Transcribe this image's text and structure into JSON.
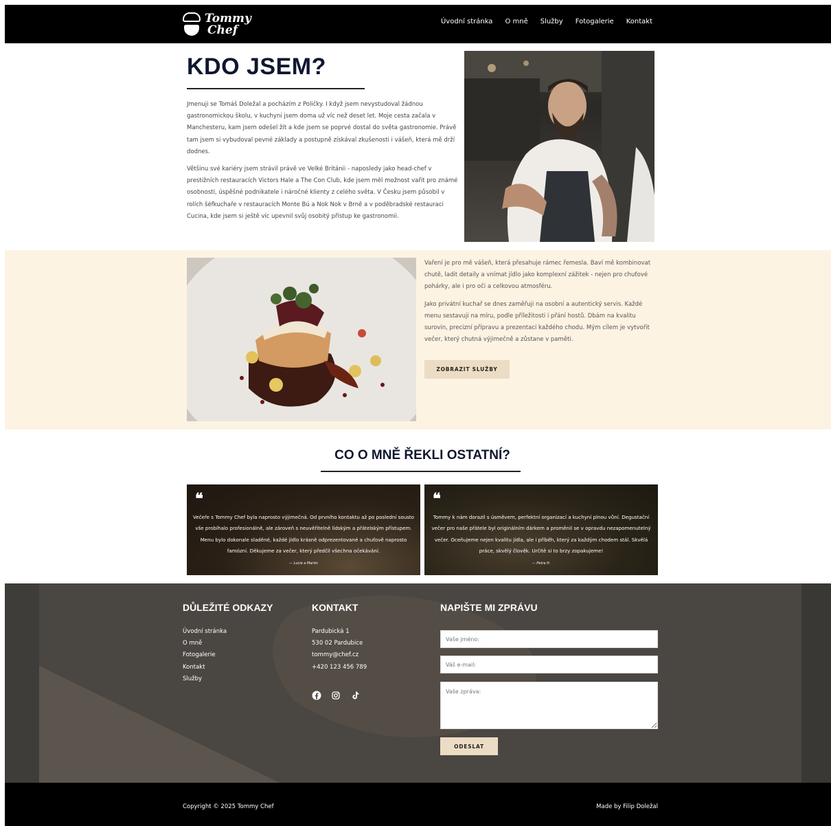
{
  "header": {
    "logo_line1": "Tommy",
    "logo_line2": "Chef",
    "nav": [
      "Úvodní stránka",
      "O mně",
      "Služby",
      "Fotogalerie",
      "Kontakt"
    ]
  },
  "about": {
    "title": "KDO JSEM?",
    "p1": "Jmenuji se Tomáš Doležal a pocházím z Poličky. I když jsem nevystudoval žádnou gastronomickou školu, v kuchyni jsem doma už víc než deset let. Moje cesta začala v Manchesteru, kam jsem odešel žít a kde jsem se poprvé dostal do světa gastronomie. Právě tam jsem si vybudoval pevné základy a postupně získával zkušenosti i vášeň, která mě drží dodnes.",
    "p2": "Většinu své kariéry jsem strávil právě ve Velké Británii - naposledy jako head-chef v prestižních restauracích Victors Hale a The Con Club, kde jsem měl možnost vařit pro známé osobnosti, úspěšné podnikatele i náročné klienty z celého světa. V Česku jsem působil v rolích šéfkuchaře v restauracích Monte Bú a Nok Nok v Brně a v poděbradské restauraci Cucina, kde jsem si ještě víc upevnil svůj osobitý přístup ke gastronomii."
  },
  "passion": {
    "p1": "Vaření je pro mě vášeň, která přesahuje rámec řemesla. Baví mě kombinovat chutě, ladit detaily a vnímat jídlo jako komplexní zážitek - nejen pro chuťové pohárky, ale i pro oči a celkovou atmosféru.",
    "p2": "Jako privátní kuchař se dnes zaměřuji na osobní a autentický servis. Každé menu sestavuji na míru, podle příležitosti i přání hostů. Dbám na kvalitu surovin, precizní přípravu a prezentaci každého chodu. Mým cílem je vytvořit večer, který chutná výjimečně a zůstane v paměti.",
    "button": "ZOBRAZIT SLUŽBY"
  },
  "reviews": {
    "title": "CO O MNĚ ŘEKLI OSTATNÍ?",
    "items": [
      {
        "mark": "❝",
        "text": "Večeře s Tommy Chef byla naprosto výjimečná. Od prvního kontaktu až po poslední sousto vše probíhalo profesionálně, ale zároveň s neuvěřitelně lidským a přátelským přístupem. Menu bylo dokonale sladěné, každé jídlo krásně odprezentované a chuťově naprosto famózní. Děkujeme za večer, který předčil všechna očekávání.",
        "author": "— Lucie a Martin"
      },
      {
        "mark": "❝",
        "text": "Tommy k nám dorazil s úsměvem, perfektní organizací a kuchyní plnou vůní. Degustační večer pro naše přátele byl originálním dárkem a proměnil se v opravdu nezapomenutelný večer. Oceňujeme nejen kvalitu jídla, ale i příběh, který za každým chodem stál. Skvělá práce, skvělý člověk. Určitě si to brzy zopakujeme!",
        "author": "— Petra H."
      }
    ]
  },
  "footer": {
    "links_title": "DŮLEŽITÉ ODKAZY",
    "links": [
      "Úvodní stránka",
      "O mně",
      "Fotogalerie",
      "Kontakt",
      "Služby"
    ],
    "contact_title": "KONTAKT",
    "contact": [
      "Pardubická 1",
      "530 02 Pardubice",
      "tommy@chef.cz",
      "+420 123 456 789"
    ],
    "socials": [
      "facebook-icon",
      "instagram-icon",
      "tiktok-icon"
    ],
    "form_title": "NAPIŠTE MI ZPRÁVU",
    "name_placeholder": "Vaše jméno:",
    "email_placeholder": "Váš e-mail:",
    "message_placeholder": "Vaše zpráva:",
    "send": "ODESLAT",
    "copyright": "Copyright © 2025 Tommy Chef",
    "made_by": "Made by Filip Doležal"
  },
  "colors": {
    "dark_navy": "#0f1730",
    "cream": "#fdf3e2",
    "button_beige": "#ecdcc4",
    "footer_bg": "#464440"
  }
}
